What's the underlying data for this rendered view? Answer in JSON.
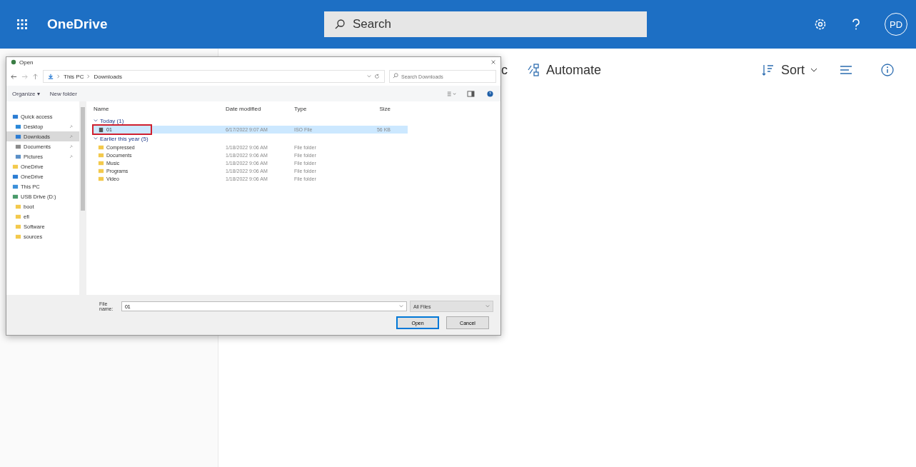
{
  "app_bar": {
    "app_name": "OneDrive",
    "search": {
      "placeholder": "Search"
    },
    "avatar": "PD"
  },
  "command_bar": {
    "cut_text": "c",
    "automate": "Automate",
    "sort": "Sort"
  },
  "dialog": {
    "title": "Open",
    "breadcrumb": [
      "This PC",
      "Downloads"
    ],
    "search": {
      "placeholder": "Search Downloads"
    },
    "toolbar": {
      "organize": "Organize ▾",
      "new_folder": "New folder"
    },
    "nav": [
      {
        "label": "Quick access",
        "kind": "star",
        "selected": false,
        "children": [
          {
            "label": "Desktop",
            "kind": "desktop",
            "selected": false,
            "pinned": true
          },
          {
            "label": "Downloads",
            "kind": "download",
            "selected": true,
            "pinned": true
          },
          {
            "label": "Documents",
            "kind": "document",
            "selected": false,
            "pinned": true
          },
          {
            "label": "Pictures",
            "kind": "pictures",
            "selected": false,
            "pinned": true
          }
        ]
      },
      {
        "label": "OneDrive",
        "kind": "folder",
        "selected": false
      },
      {
        "label": "OneDrive",
        "kind": "cloud",
        "selected": false
      },
      {
        "label": "This PC",
        "kind": "pc",
        "selected": false
      },
      {
        "label": "USB Drive (D:)",
        "kind": "drive",
        "selected": false,
        "children": [
          {
            "label": "boot",
            "kind": "folder",
            "selected": false,
            "pinned": false
          },
          {
            "label": "efi",
            "kind": "folder",
            "selected": false,
            "pinned": false
          },
          {
            "label": "Software",
            "kind": "folder",
            "selected": false,
            "pinned": false
          },
          {
            "label": "sources",
            "kind": "folder",
            "selected": false,
            "pinned": false
          }
        ]
      }
    ],
    "columns": [
      "Name",
      "Date modified",
      "Type",
      "Size"
    ],
    "groups": [
      {
        "label": "Today (1)",
        "items": [
          {
            "name": "01",
            "kind": "file",
            "date": "6/17/2022 9:07 AM",
            "type": "ISO File",
            "size": "56 KB",
            "selected": true,
            "annotated": true
          }
        ]
      },
      {
        "label": "Earlier this year (5)",
        "items": [
          {
            "name": "Compressed",
            "kind": "folder",
            "date": "1/18/2022 9:06 AM",
            "type": "File folder",
            "selected": false,
            "annotated": false
          },
          {
            "name": "Documents",
            "kind": "folder",
            "date": "1/18/2022 9:06 AM",
            "type": "File folder",
            "selected": false,
            "annotated": false
          },
          {
            "name": "Music",
            "kind": "folder",
            "date": "1/18/2022 9:06 AM",
            "type": "File folder",
            "selected": false,
            "annotated": false
          },
          {
            "name": "Programs",
            "kind": "folder",
            "date": "1/18/2022 9:06 AM",
            "type": "File folder",
            "selected": false,
            "annotated": false
          },
          {
            "name": "Video",
            "kind": "folder",
            "date": "1/18/2022 9:06 AM",
            "type": "File folder",
            "selected": false,
            "annotated": false
          }
        ]
      }
    ],
    "file_name": {
      "label": "File name:",
      "value": "01"
    },
    "filter": "All Files",
    "buttons": [
      "Open",
      "Cancel"
    ]
  }
}
